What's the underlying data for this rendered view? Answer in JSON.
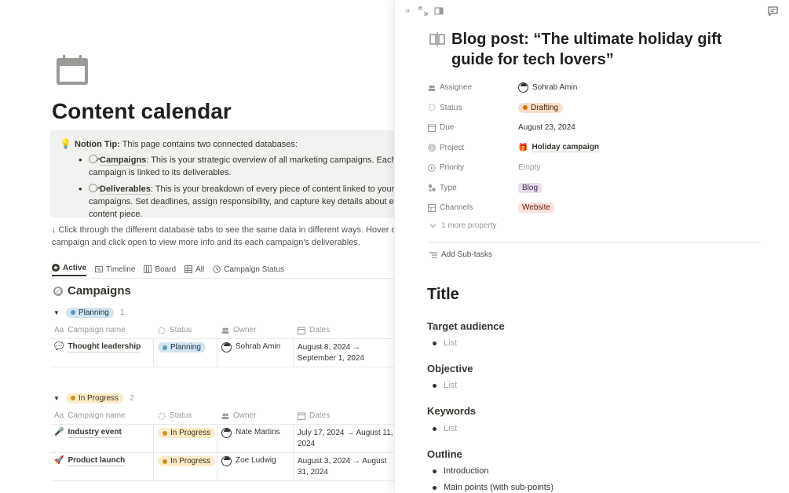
{
  "page": {
    "title": "Content calendar",
    "callout": {
      "emoji": "💡",
      "tip_label": "Notion Tip:",
      "tip_text": " This page contains two connected databases:",
      "items": [
        {
          "link": "Campaigns",
          "text": ": This is your strategic overview of all marketing campaigns. Each campaign is linked to its deliverables."
        },
        {
          "link": "Deliverables",
          "text": ": This is your breakdown of every piece of content linked to your campaigns. Set deadlines, assign responsibility, and capture key details about each content piece."
        }
      ]
    },
    "hint": "↓ Click through the different database tabs to see the same data in different ways. Hover over a campaign and click open to view more info and its each campaign's deliverables.",
    "tabs": [
      {
        "label": "Active",
        "icon": "star-circle-icon"
      },
      {
        "label": "Timeline",
        "icon": "timeline-icon"
      },
      {
        "label": "Board",
        "icon": "board-icon"
      },
      {
        "label": "All",
        "icon": "table-icon"
      },
      {
        "label": "Campaign Status",
        "icon": "status-icon"
      }
    ],
    "database_title": "Campaigns",
    "columns": {
      "name": "Campaign name",
      "status": "Status",
      "owner": "Owner",
      "dates": "Dates",
      "name_prefix": "Aa"
    },
    "groups": [
      {
        "label": "Planning",
        "count": "1",
        "rows": [
          {
            "emoji": "💬",
            "name": "Thought leadership",
            "status": "Planning",
            "owner": "Sohrab Amin",
            "dates": "August 8, 2024 → September 1, 2024"
          }
        ]
      },
      {
        "label": "In Progress",
        "count": "2",
        "rows": [
          {
            "emoji": "🎤",
            "name": "Industry event",
            "status": "In Progress",
            "owner": "Nate Martins",
            "dates": "July 17, 2024 → August 11, 2024"
          },
          {
            "emoji": "🚀",
            "name": "Product launch",
            "status": "In Progress",
            "owner": "Zoe Ludwig",
            "dates": "August 3, 2024 → August 31, 2024"
          }
        ]
      }
    ]
  },
  "panel": {
    "title": "Blog post: “The ultimate holiday gift guide for tech lovers”",
    "properties": {
      "assignee": {
        "label": "Assignee",
        "value": "Sohrab Amin"
      },
      "status": {
        "label": "Status",
        "value": "Drafting"
      },
      "due": {
        "label": "Due",
        "value": "August 23, 2024"
      },
      "project": {
        "label": "Project",
        "value": "Holiday campaign",
        "emoji": "🎁"
      },
      "priority": {
        "label": "Priority",
        "value": "Empty"
      },
      "type": {
        "label": "Type",
        "value": "Blog"
      },
      "channels": {
        "label": "Channels",
        "value": "Website"
      }
    },
    "more_property": "1 more property",
    "add_subtasks": "Add Sub-tasks",
    "content": {
      "h1": "Title",
      "target_audience": "Target audience",
      "objective": "Objective",
      "keywords": "Keywords",
      "outline": "Outline",
      "list_placeholder": "List",
      "outline_items": [
        "Introduction",
        "Main points (with sub-points)"
      ]
    }
  },
  "colors": {
    "planning": "#5b97bd",
    "in_progress": "#cb912f",
    "drafting": "#d9730d",
    "blog_tag": "#e8deee",
    "website_tag": "#ffe2dd"
  }
}
